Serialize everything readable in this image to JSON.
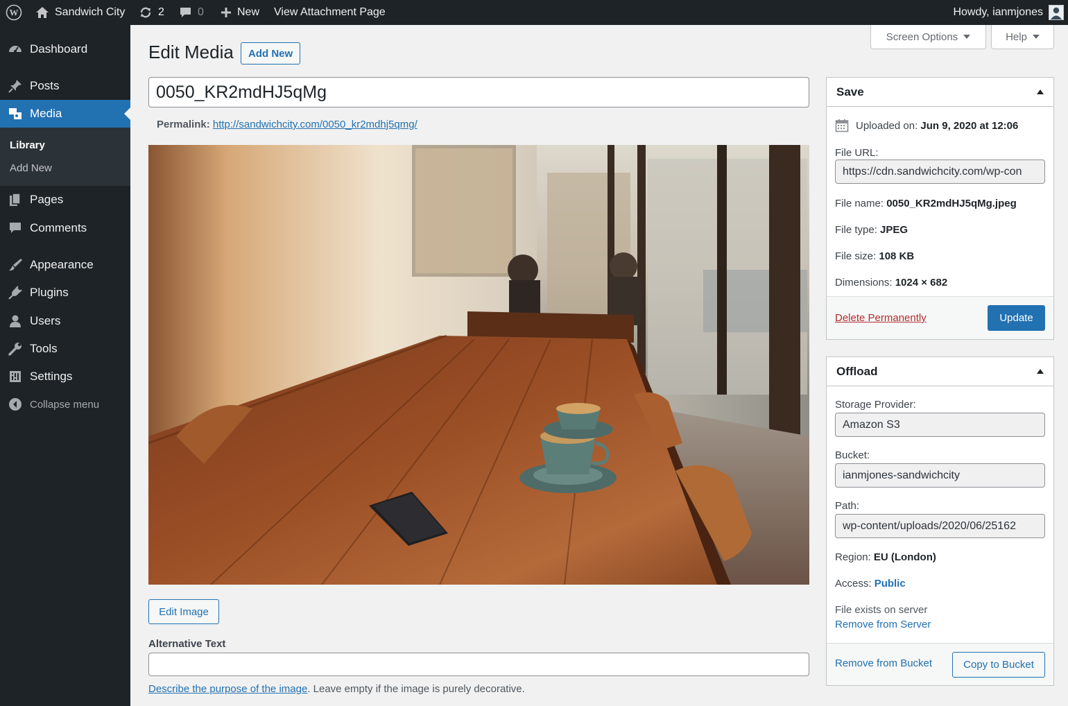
{
  "adminbar": {
    "site_name": "Sandwich City",
    "updates_count": "2",
    "comments_count": "0",
    "new_label": "New",
    "view_label": "View Attachment Page",
    "howdy": "Howdy, ianmjones"
  },
  "sidebar": {
    "items": [
      {
        "label": "Dashboard",
        "icon": "dashboard-icon"
      },
      {
        "label": "Posts",
        "icon": "pin-icon"
      },
      {
        "label": "Media",
        "icon": "media-icon"
      },
      {
        "label": "Pages",
        "icon": "pages-icon"
      },
      {
        "label": "Comments",
        "icon": "comment-icon"
      },
      {
        "label": "Appearance",
        "icon": "brush-icon"
      },
      {
        "label": "Plugins",
        "icon": "plug-icon"
      },
      {
        "label": "Users",
        "icon": "user-icon"
      },
      {
        "label": "Tools",
        "icon": "wrench-icon"
      },
      {
        "label": "Settings",
        "icon": "settings-icon"
      }
    ],
    "submenu": {
      "library": "Library",
      "add_new": "Add New"
    },
    "collapse": "Collapse menu"
  },
  "header": {
    "title": "Edit Media",
    "add_new": "Add New",
    "screen_options": "Screen Options",
    "help": "Help"
  },
  "main": {
    "title_value": "0050_KR2mdHJ5qMg",
    "permalink_label": "Permalink:",
    "permalink_url": "http://sandwichcity.com/0050_kr2mdhj5qmg/",
    "edit_image": "Edit Image",
    "alt_label": "Alternative Text",
    "alt_value": "",
    "alt_help_link": "Describe the purpose of the image",
    "alt_help_rest": ". Leave empty if the image is purely decorative."
  },
  "save_box": {
    "title": "Save",
    "uploaded_label": "Uploaded on:",
    "uploaded_value": "Jun 9, 2020 at 12:06",
    "file_url_label": "File URL:",
    "file_url_value": "https://cdn.sandwichcity.com/wp-con",
    "file_name_label": "File name:",
    "file_name_value": "0050_KR2mdHJ5qMg.jpeg",
    "file_type_label": "File type:",
    "file_type_value": "JPEG",
    "file_size_label": "File size:",
    "file_size_value": "108 KB",
    "dimensions_label": "Dimensions:",
    "dimensions_value": "1024 × 682",
    "delete": "Delete Permanently",
    "update": "Update"
  },
  "offload_box": {
    "title": "Offload",
    "provider_label": "Storage Provider:",
    "provider_value": "Amazon S3",
    "bucket_label": "Bucket:",
    "bucket_value": "ianmjones-sandwichcity",
    "path_label": "Path:",
    "path_value": "wp-content/uploads/2020/06/25162",
    "region_label": "Region:",
    "region_value": "EU (London)",
    "access_label": "Access:",
    "access_value": "Public",
    "server_status": "File exists on server",
    "remove_server": "Remove from Server",
    "remove_bucket": "Remove from Bucket",
    "copy_bucket": "Copy to Bucket"
  },
  "colors": {
    "accent": "#2271b1",
    "adminbar_bg": "#1d2327",
    "sidebar_bg": "#1d2327",
    "danger": "#b32d2e"
  }
}
